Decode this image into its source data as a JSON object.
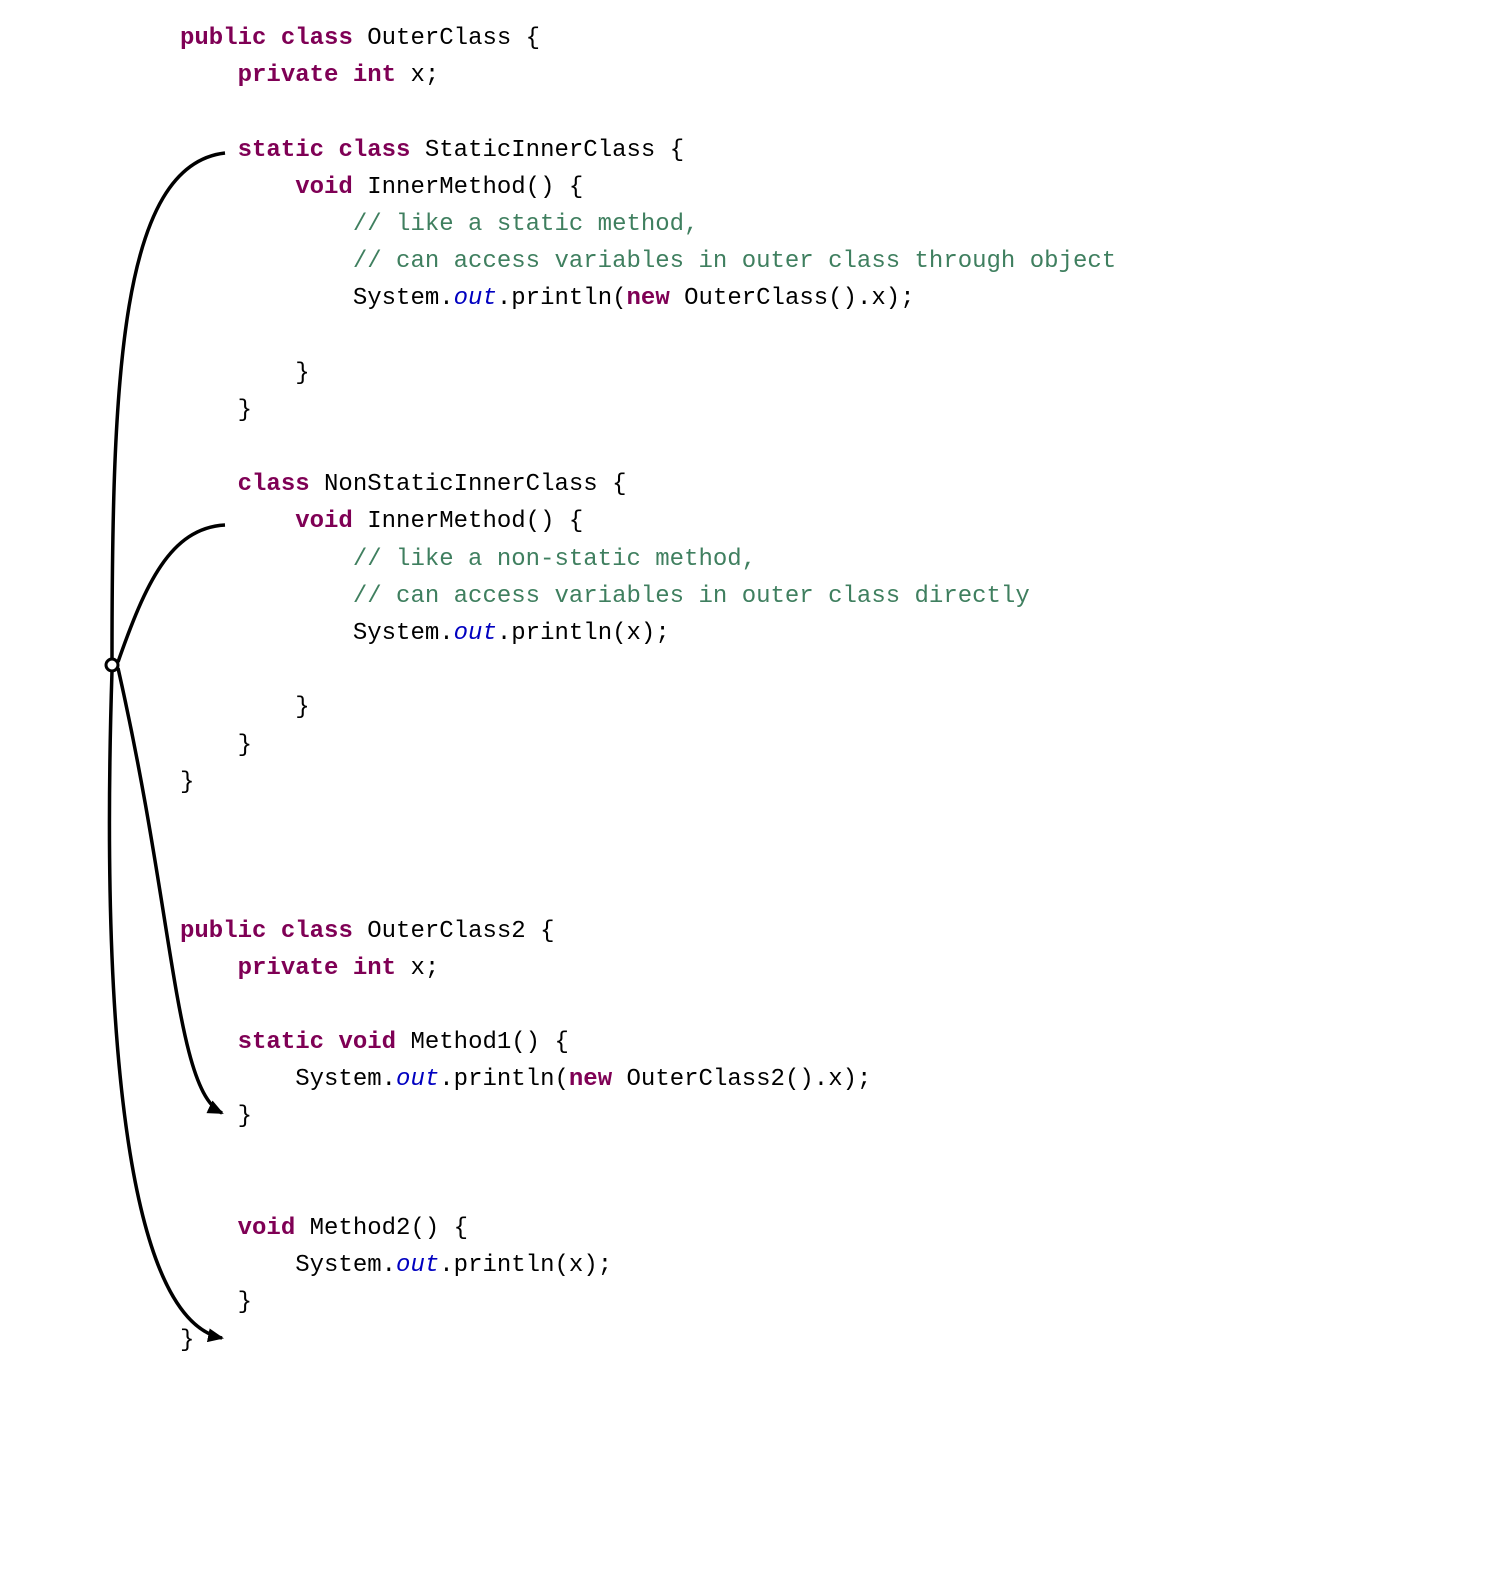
{
  "tokens": {
    "kw_public": "public",
    "kw_class": "class",
    "kw_private": "private",
    "kw_int": "int",
    "kw_static": "static",
    "kw_void": "void",
    "kw_new": "new",
    "id_outer": "OuterClass",
    "id_x": "x",
    "id_static_inner": "StaticInnerClass",
    "id_inner_method": "InnerMethod",
    "id_nonstatic_inner": "NonStaticInnerClass",
    "id_outer2": "OuterClass2",
    "id_method1": "Method1",
    "id_method2": "Method2",
    "id_system": "System",
    "id_out": "out",
    "id_println": "println",
    "cm_static1": "// like a static method,",
    "cm_static2": "// can access variables in outer class through object",
    "cm_nonstatic1": "// like a non-static method,",
    "cm_nonstatic2": "// can access variables in outer class directly"
  }
}
